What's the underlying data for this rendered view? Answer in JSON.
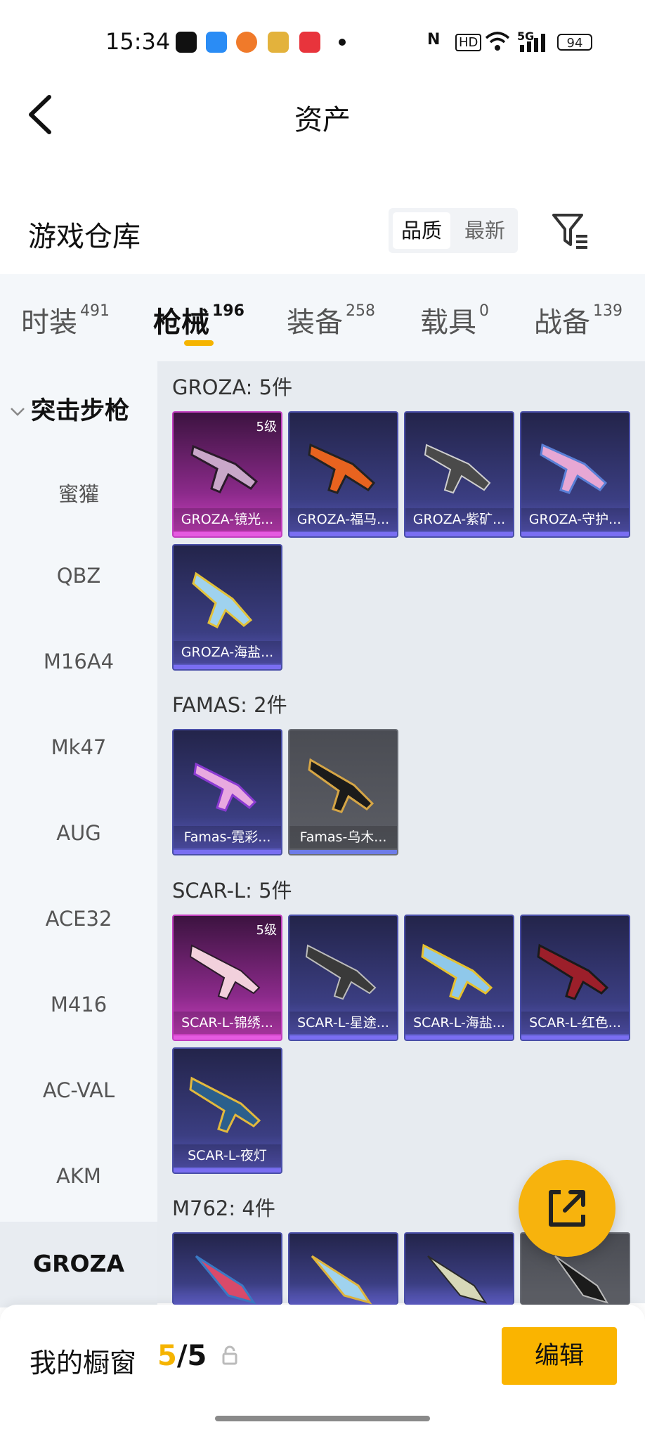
{
  "status_bar": {
    "time": "15:34",
    "indicators": [
      "N",
      "HD",
      "wifi-icon",
      "5G",
      "signal-icon"
    ],
    "battery": "94"
  },
  "header": {
    "title": "资产"
  },
  "section": {
    "title": "游戏仓库",
    "sort_options": [
      "品质",
      "最新"
    ]
  },
  "tabs": [
    {
      "label": "时装",
      "count": "491"
    },
    {
      "label": "枪械",
      "count": "196"
    },
    {
      "label": "装备",
      "count": "258"
    },
    {
      "label": "载具",
      "count": "0"
    },
    {
      "label": "战备",
      "count": "139"
    }
  ],
  "sidebar": {
    "group": "突击步枪",
    "items": [
      "蜜獾",
      "QBZ",
      "M16A4",
      "Mk47",
      "AUG",
      "ACE32",
      "M416",
      "AC-VAL",
      "AKM",
      "GROZA"
    ]
  },
  "categories": [
    {
      "title": "GROZA: 5件",
      "items": [
        {
          "label": "GROZA-镜光...",
          "level": "5级",
          "quality": "pink"
        },
        {
          "label": "GROZA-福马...",
          "quality": "purple"
        },
        {
          "label": "GROZA-紫矿...",
          "quality": "purple"
        },
        {
          "label": "GROZA-守护...",
          "quality": "purple"
        },
        {
          "label": "GROZA-海盐...",
          "quality": "purple"
        }
      ]
    },
    {
      "title": "FAMAS: 2件",
      "items": [
        {
          "label": "Famas-霓彩...",
          "quality": "purple"
        },
        {
          "label": "Famas-乌木...",
          "quality": "gray"
        }
      ]
    },
    {
      "title": "SCAR-L: 5件",
      "items": [
        {
          "label": "SCAR-L-锦绣...",
          "level": "5级",
          "quality": "pink"
        },
        {
          "label": "SCAR-L-星途...",
          "quality": "purple"
        },
        {
          "label": "SCAR-L-海盐...",
          "quality": "purple"
        },
        {
          "label": "SCAR-L-红色...",
          "quality": "purple"
        },
        {
          "label": "SCAR-L-夜灯",
          "quality": "purple"
        }
      ]
    },
    {
      "title": "M762: 4件",
      "items": []
    }
  ],
  "bottom": {
    "showcase_label": "我的橱窗",
    "count_current": "5",
    "count_sep": "/",
    "count_total": "5",
    "edit_label": "编辑"
  },
  "colors": {
    "accent": "#f5b400",
    "card_purple": "#3b3e82",
    "card_pink": "#d042c4",
    "card_gray": "#5d5f66"
  }
}
